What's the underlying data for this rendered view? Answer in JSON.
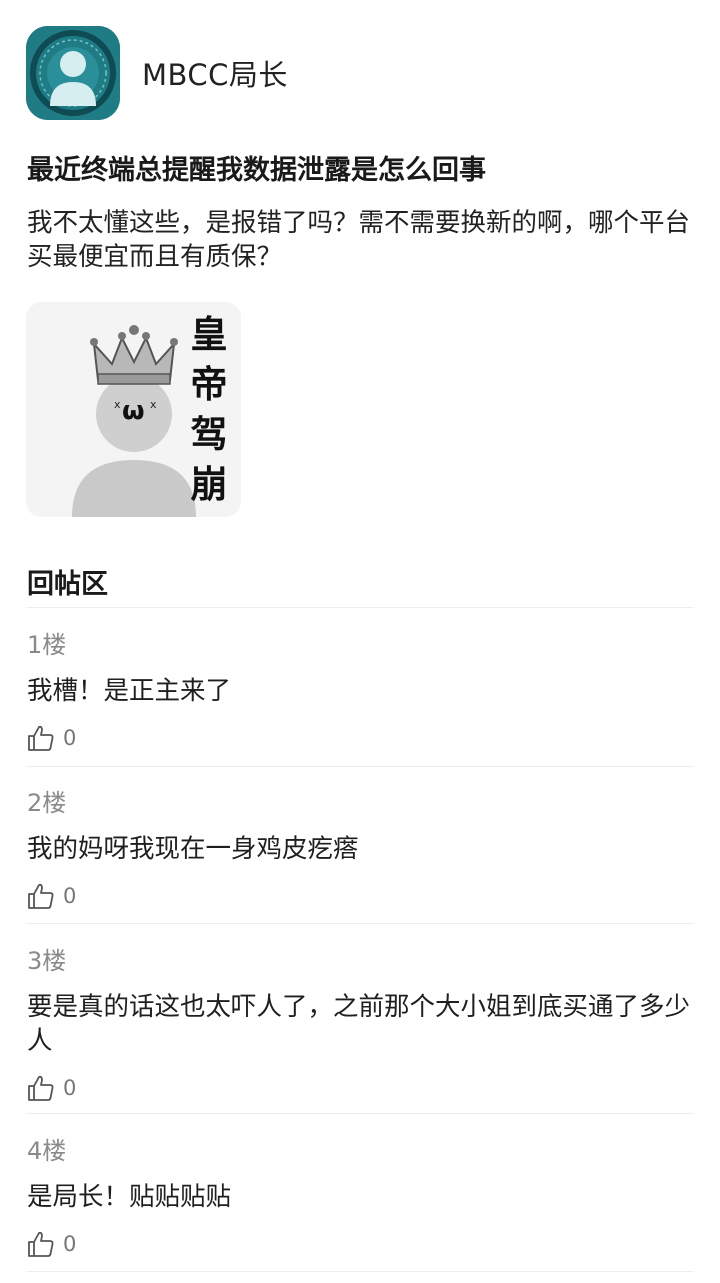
{
  "post": {
    "username": "MBCC局长",
    "title": "最近终端总提醒我数据泄露是怎么回事",
    "body": "我不太懂这些，是报错了吗？需不需要换新的啊，哪个平台买最便宜而且有质保？",
    "sticker": {
      "chars": [
        "皇",
        "帝",
        "驾",
        "崩"
      ],
      "face": "ω"
    }
  },
  "replies_section": {
    "title": "回帖区",
    "items": [
      {
        "floor": "1楼",
        "text": "我槽！是正主来了",
        "likes": "0"
      },
      {
        "floor": "2楼",
        "text": "我的妈呀我现在一身鸡皮疙瘩",
        "likes": "0"
      },
      {
        "floor": "3楼",
        "text": "要是真的话这也太吓人了，之前那个大小姐到底买通了多少人",
        "likes": "0"
      },
      {
        "floor": "4楼",
        "text": "是局长！贴贴贴贴",
        "likes": "0"
      }
    ]
  },
  "icons": {
    "like": "thumbs-up-icon",
    "avatar": "user-silhouette-icon"
  },
  "colors": {
    "avatar_bg": "#1f7b84",
    "floor_text": "#8a8a8a"
  }
}
